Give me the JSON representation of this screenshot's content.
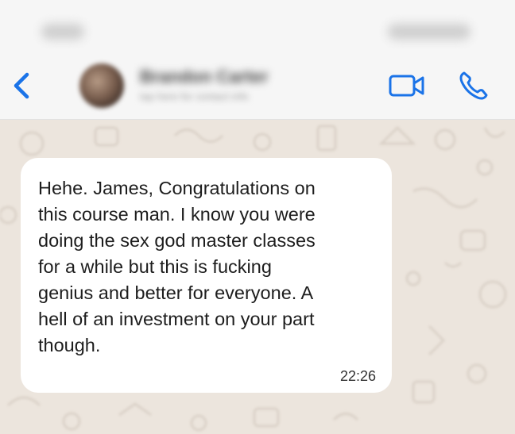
{
  "status_bar": {},
  "header": {
    "back_icon": "chevron-left-icon",
    "contact_name": "Brandon Carter",
    "contact_subtitle": "tap here for contact info",
    "video_icon": "video-camera-icon",
    "call_icon": "phone-icon",
    "accent_color": "#1a73e8"
  },
  "chat": {
    "messages": [
      {
        "text": "Hehe. James, Congratulations on\nthis course man. I know you were\ndoing the sex god master classes\nfor a while but this is fucking\ngenius and better for everyone. A\nhell of an investment on your part\nthough.",
        "time": "22:26",
        "direction": "incoming"
      }
    ]
  }
}
